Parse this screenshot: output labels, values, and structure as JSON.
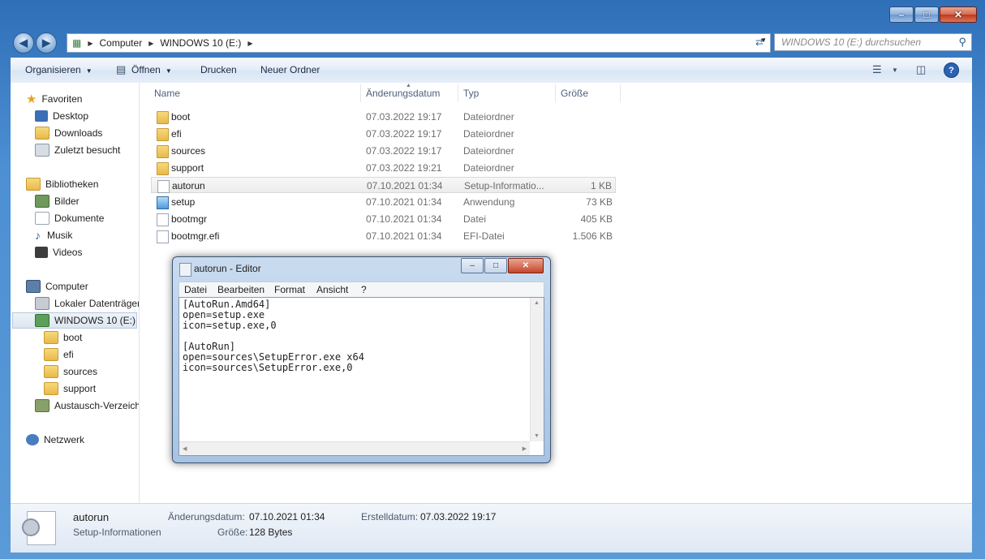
{
  "explorer": {
    "address": {
      "root": "Computer",
      "drive": "WINDOWS 10 (E:)"
    },
    "search_placeholder": "WINDOWS 10 (E:) durchsuchen",
    "toolbar": {
      "organize": "Organisieren",
      "open": "Öffnen",
      "print": "Drucken",
      "new_folder": "Neuer Ordner",
      "help": "?"
    },
    "nav": {
      "favorites": "Favoriten",
      "desktop": "Desktop",
      "downloads": "Downloads",
      "recent": "Zuletzt besucht",
      "libraries": "Bibliotheken",
      "pictures": "Bilder",
      "documents": "Dokumente",
      "music": "Musik",
      "videos": "Videos",
      "computer": "Computer",
      "local_disk": "Lokaler Datenträger",
      "windows10": "WINDOWS 10 (E:)",
      "boot": "boot",
      "efi": "efi",
      "sources": "sources",
      "support": "support",
      "exchange": "Austausch-Verzeichnis",
      "network": "Netzwerk"
    },
    "columns": {
      "name": "Name",
      "date": "Änderungsdatum",
      "type": "Typ",
      "size": "Größe"
    },
    "files": [
      {
        "name": "boot",
        "date": "07.03.2022 19:17",
        "type": "Dateiordner",
        "size": "",
        "icon": "folder"
      },
      {
        "name": "efi",
        "date": "07.03.2022 19:17",
        "type": "Dateiordner",
        "size": "",
        "icon": "folder"
      },
      {
        "name": "sources",
        "date": "07.03.2022 19:17",
        "type": "Dateiordner",
        "size": "",
        "icon": "folder"
      },
      {
        "name": "support",
        "date": "07.03.2022 19:21",
        "type": "Dateiordner",
        "size": "",
        "icon": "folder"
      },
      {
        "name": "autorun",
        "date": "07.10.2021 01:34",
        "type": "Setup-Informatio...",
        "size": "1 KB",
        "icon": "inf"
      },
      {
        "name": "setup",
        "date": "07.10.2021 01:34",
        "type": "Anwendung",
        "size": "73 KB",
        "icon": "exe"
      },
      {
        "name": "bootmgr",
        "date": "07.10.2021 01:34",
        "type": "Datei",
        "size": "405 KB",
        "icon": "file"
      },
      {
        "name": "bootmgr.efi",
        "date": "07.10.2021 01:34",
        "type": "EFI-Datei",
        "size": "1.506 KB",
        "icon": "file"
      }
    ],
    "details": {
      "name": "autorun",
      "kind": "Setup-Informationen",
      "modified_label": "Änderungsdatum:",
      "modified": "07.10.2021 01:34",
      "size_label": "Größe:",
      "size": "128 Bytes",
      "created_label": "Erstelldatum:",
      "created": "07.03.2022 19:17"
    }
  },
  "notepad": {
    "title": "autorun - Editor",
    "menu": {
      "file": "Datei",
      "edit": "Bearbeiten",
      "format": "Format",
      "view": "Ansicht",
      "help": "?"
    },
    "content": "[AutoRun.Amd64]\nopen=setup.exe\nicon=setup.exe,0\n\n[AutoRun]\nopen=sources\\SetupError.exe x64\nicon=sources\\SetupError.exe,0"
  },
  "colors": {
    "selected_row": "#ececec",
    "window_frame": "#4d8fd3",
    "folder": "#e8b94a"
  }
}
